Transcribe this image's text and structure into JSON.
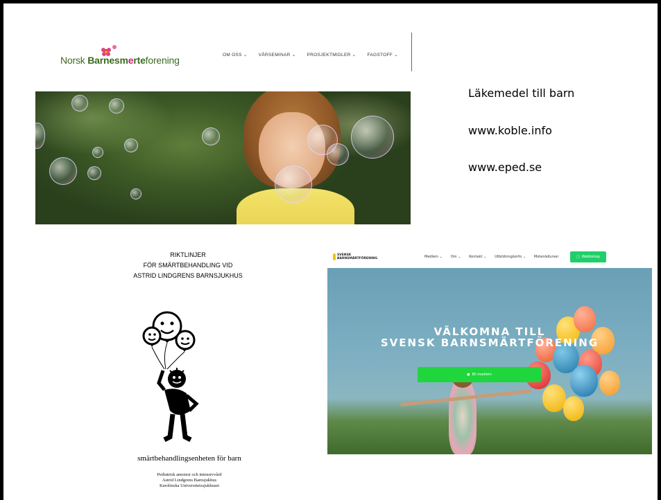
{
  "norsk": {
    "logo_prefix": "Norsk ",
    "logo_bold": "Barnesm",
    "logo_pink": "e",
    "logo_bold2": "rte",
    "logo_suffix": "forening",
    "nav": [
      "OM OSS ⌄",
      "VÅRSEMINAR ⌄",
      "PROSJEKTMIDLER ⌄",
      "FAGSTOFF ⌄"
    ]
  },
  "right_links": {
    "line1": "Läkemedel till barn",
    "line2": "www.koble.info",
    "line3": "www.eped.se"
  },
  "doc": {
    "title_line1": "RIKTLINJER",
    "title_line2": "FÖR SMÄRTBEHANDLING VID",
    "title_line3": "ASTRID LINDGRENS BARNSJUKHUS",
    "unit": "smärtbehandlingsenheten för barn",
    "footer_line1": "Pediatrisk anestesi och intensivvård",
    "footer_line2": "Astrid Lindgrens Barnsjukhus",
    "footer_line3": "Karolinska Universitetssjukhuset"
  },
  "svensk": {
    "logo_line1": "SVENSK",
    "logo_line2": "BARNSMÄRTFÖRENING",
    "nav": [
      "Medlem ⌄",
      "Om ⌄",
      "Kontakt ⌄",
      "Utbildning&info ⌄",
      "Moten&Kurser"
    ],
    "shop_label": "Webbshop",
    "hero_title_line1": "VÄLKOMNA TILL",
    "hero_title_line2": "SVENSK BARNSMÄRTFÖRENING",
    "cta_label": "Bli medlem"
  },
  "colors": {
    "norsk_green": "#3b6b1f",
    "norsk_pink": "#d01c6e",
    "svensk_green": "#1fd63c",
    "svensk_yellow": "#f2c400"
  }
}
